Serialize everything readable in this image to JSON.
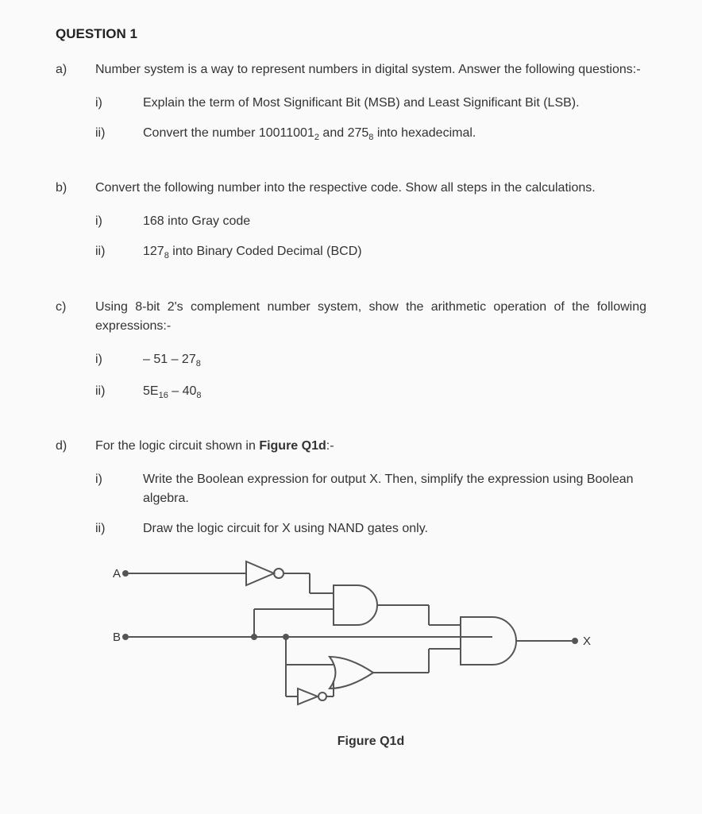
{
  "title": "QUESTION 1",
  "a": {
    "label": "a)",
    "intro": "Number system is a way to represent numbers in digital system. Answer the following questions:-",
    "i_label": "i)",
    "i_text": "Explain the term of Most Significant Bit (MSB) and Least Significant Bit (LSB).",
    "ii_label": "ii)",
    "ii_pre": "Convert the number 10011001",
    "ii_sub1": "2",
    "ii_mid": " and 275",
    "ii_sub2": "8",
    "ii_post": " into hexadecimal."
  },
  "b": {
    "label": "b)",
    "intro": "Convert the following number into the respective code. Show all steps in the calculations.",
    "i_label": "i)",
    "i_text": "168 into Gray code",
    "ii_label": "ii)",
    "ii_pre": "127",
    "ii_sub": "8",
    "ii_post": " into Binary Coded Decimal (BCD)"
  },
  "c": {
    "label": "c)",
    "intro": "Using 8-bit 2's complement number system, show the arithmetic operation of the following expressions:-",
    "i_label": "i)",
    "i_pre": "– 51 – 27",
    "i_sub": "8",
    "ii_label": "ii)",
    "ii_pre": "5E",
    "ii_sub1": "16",
    "ii_mid": " – 40",
    "ii_sub2": "8"
  },
  "d": {
    "label": "d)",
    "intro_pre": "For the logic circuit shown in ",
    "intro_bold": "Figure Q1d",
    "intro_post": ":-",
    "i_label": "i)",
    "i_text": "Write the Boolean expression for output X. Then, simplify the expression using Boolean algebra.",
    "ii_label": "ii)",
    "ii_text": "Draw the logic circuit for X using NAND gates only.",
    "inputA": "A",
    "inputB": "B",
    "outputX": "X",
    "caption": "Figure Q1d"
  }
}
